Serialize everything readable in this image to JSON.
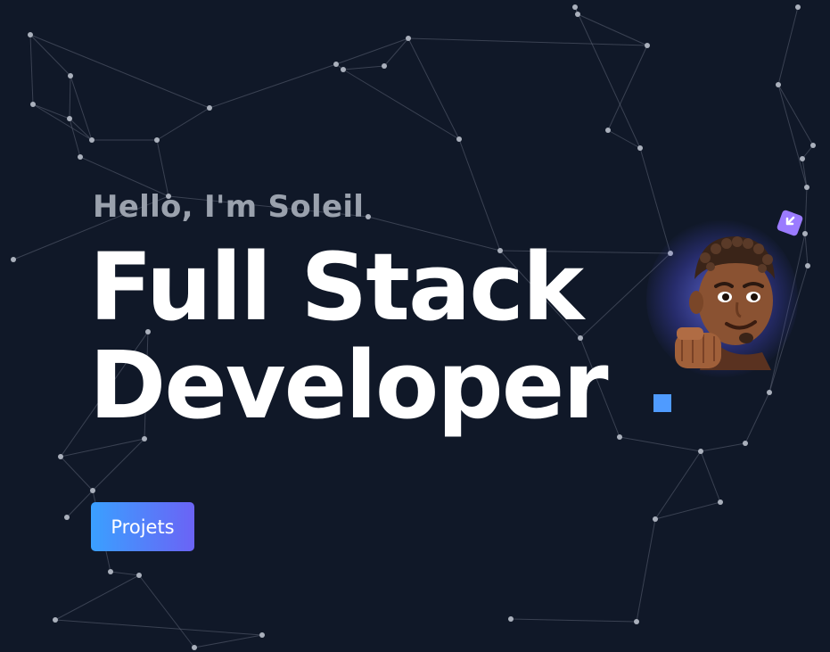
{
  "hero": {
    "greeting": "Hello, I'm Soleil",
    "title_line1": "Full Stack",
    "title_line2": "Developer",
    "cta_label": "Projets"
  },
  "colors": {
    "background": "#101828",
    "accent": "#4f9bff",
    "button_gradient_start": "#3aa0ff",
    "button_gradient_end": "#6b63f5",
    "greeting": "#9aa1ad"
  },
  "icons": {
    "avatar": "memoji-avatar-fist-icon",
    "sparkle": "purple-sparkle-icon"
  }
}
